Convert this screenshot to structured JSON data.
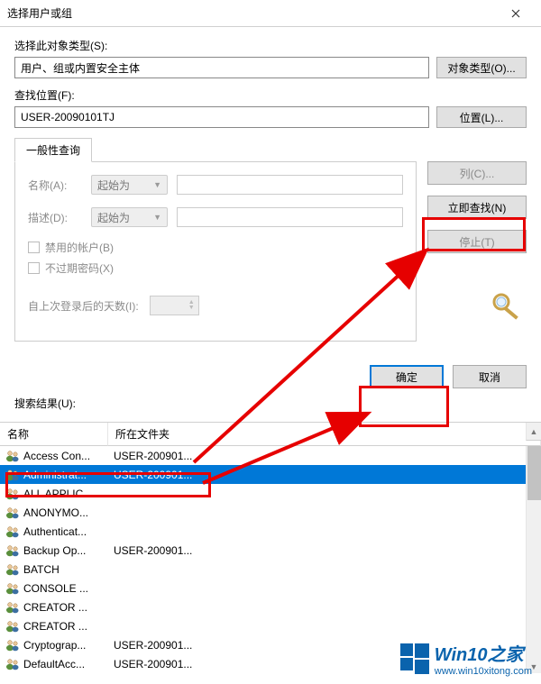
{
  "titlebar": {
    "title": "选择用户或组"
  },
  "labels": {
    "object_type": "选择此对象类型(S):",
    "location": "查找位置(F):",
    "results": "搜索结果(U):"
  },
  "inputs": {
    "object_type_value": "用户、组或内置安全主体",
    "location_value": "USER-20090101TJ"
  },
  "buttons": {
    "object_types": "对象类型(O)...",
    "locations": "位置(L)...",
    "columns": "列(C)...",
    "find_now": "立即查找(N)",
    "stop": "停止(T)",
    "ok": "确定",
    "cancel": "取消"
  },
  "tab": {
    "label": "一般性查询"
  },
  "query": {
    "name_label": "名称(A):",
    "name_op": "起始为",
    "desc_label": "描述(D):",
    "desc_op": "起始为",
    "chk_disabled": "禁用的帐户(B)",
    "chk_no_expire": "不过期密码(X)",
    "days_label": "自上次登录后的天数(I):"
  },
  "grid": {
    "col_name": "名称",
    "col_folder": "所在文件夹",
    "rows": [
      {
        "name": "Access Con...",
        "folder": "USER-200901..."
      },
      {
        "name": "Administrat...",
        "folder": "USER-200901...",
        "selected": true
      },
      {
        "name": "ALL APPLIC...",
        "folder": ""
      },
      {
        "name": "ANONYMO...",
        "folder": ""
      },
      {
        "name": "Authenticat...",
        "folder": ""
      },
      {
        "name": "Backup Op...",
        "folder": "USER-200901..."
      },
      {
        "name": "BATCH",
        "folder": ""
      },
      {
        "name": "CONSOLE ...",
        "folder": ""
      },
      {
        "name": "CREATOR ...",
        "folder": ""
      },
      {
        "name": "CREATOR ...",
        "folder": ""
      },
      {
        "name": "Cryptograp...",
        "folder": "USER-200901..."
      },
      {
        "name": "DefaultAcc...",
        "folder": "USER-200901..."
      }
    ]
  },
  "watermark": {
    "brand": "Win10之家",
    "url": "www.win10xitong.com"
  }
}
